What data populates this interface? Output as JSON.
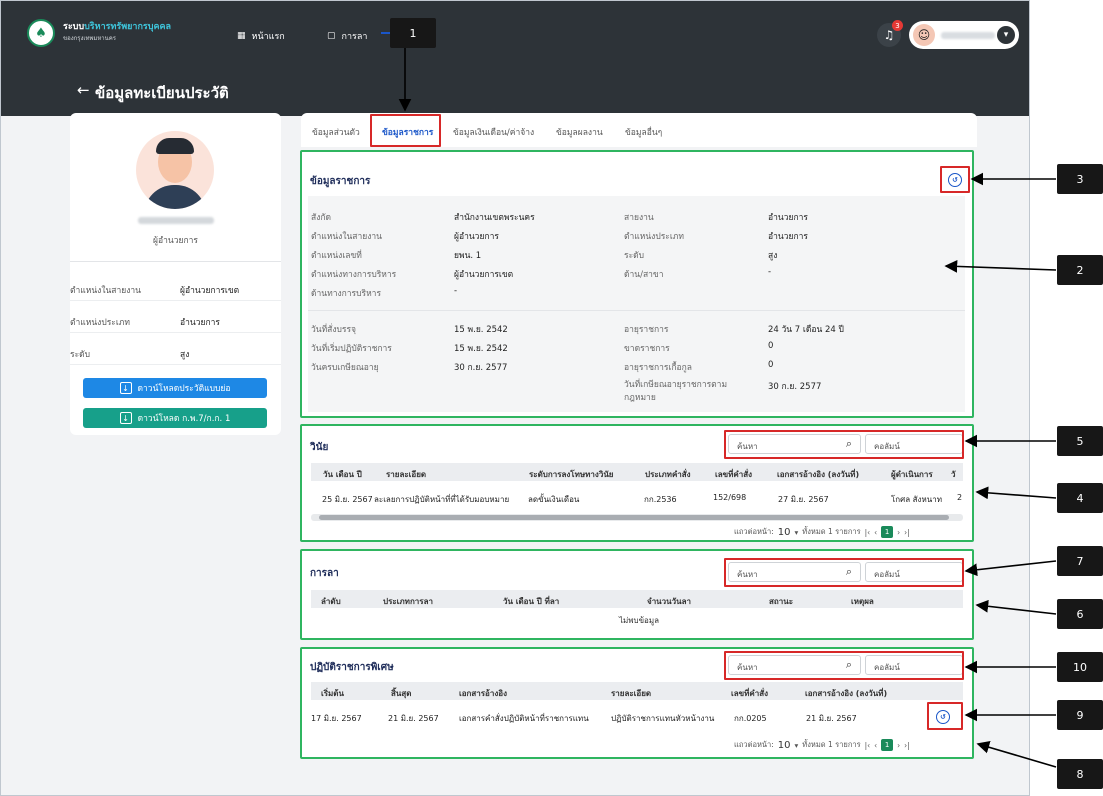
{
  "app": {
    "brand_main": "ระบบ",
    "brand_highlight": "บริหารทรัพยากรบุคคล",
    "brand_sub": "ของกรุงเทพมหานคร",
    "nav_home": "หน้าแรก",
    "nav_leave": "การลา",
    "notifications": "3"
  },
  "page": {
    "title": "ข้อมูลทะเบียนประวัติ"
  },
  "profile": {
    "role": "ผู้อำนวยการ",
    "rows": [
      {
        "k": "ตำแหน่งในสายงาน",
        "v": "ผู้อำนวยการเขต"
      },
      {
        "k": "ตำแหน่งประเภท",
        "v": "อำนวยการ"
      },
      {
        "k": "ระดับ",
        "v": "สูง"
      }
    ],
    "btn_download_profile": "ดาวน์โหลดประวัติแบบย่อ",
    "btn_download_gp7": "ดาวน์โหลด ก.พ.7/ก.ก. 1"
  },
  "tabs": [
    "ข้อมูลส่วนตัว",
    "ข้อมูลราชการ",
    "ข้อมูลเงินเดือน/ค่าจ้าง",
    "ข้อมูลผลงาน",
    "ข้อมูลอื่นๆ"
  ],
  "official": {
    "title": "ข้อมูลราชการ",
    "fields": {
      "affiliation_k": "สังกัด",
      "affiliation_v": "สำนักงานเขตพระนคร",
      "line_k": "สายงาน",
      "line_v": "อำนวยการ",
      "pos_line_k": "ตำแหน่งในสายงาน",
      "pos_line_v": "ผู้อำนวยการ",
      "pos_type_k": "ตำแหน่งประเภท",
      "pos_type_v": "อำนวยการ",
      "pos_no_k": "ตำแหน่งเลขที่",
      "pos_no_v": "ยพน. 1",
      "level_k": "ระดับ",
      "level_v": "สูง",
      "mgmt_pos_k": "ตำแหน่งทางการบริหาร",
      "mgmt_pos_v": "ผู้อำนวยการเขต",
      "field_k": "ด้าน/สาขา",
      "field_v": "-",
      "mgmt_side_k": "ด้านทางการบริหาร",
      "mgmt_side_v": "-",
      "appoint_k": "วันที่สั่งบรรจุ",
      "appoint_v": "15 พ.ย. 2542",
      "service_age_k": "อายุราชการ",
      "service_age_v": "24 วัน 7 เดือน 24 ปี",
      "start_k": "วันที่เริ่มปฏิบัติราชการ",
      "start_v": "15 พ.ย. 2542",
      "absent_k": "ขาดราชการ",
      "absent_v": "0",
      "retire_k": "วันครบเกษียณอายุ",
      "retire_v": "30 ก.ย. 2577",
      "support_k": "อายุราชการเกื้อกูล",
      "support_v": "0",
      "retire_law_k": "วันที่เกษียณอายุราชการตามกฎหมาย",
      "retire_law_v": "30 ก.ย. 2577"
    }
  },
  "discipline": {
    "title": "วินัย",
    "search_placeholder": "ค้นหา",
    "column_placeholder": "คอลัมน์",
    "headers": [
      "วัน เดือน ปี",
      "รายละเอียด",
      "ระดับการลงโทษทางวินัย",
      "ประเภทคำสั่ง",
      "เลขที่คำสั่ง",
      "เอกสารอ้างอิง (ลงวันที่)",
      "ผู้ดำเนินการ",
      "วั"
    ],
    "row": [
      "25 มิ.ย. 2567",
      "ละเลยการปฏิบัติหน้าที่ที่ได้รับมอบหมาย",
      "ลดขั้นเงินเดือน",
      "กก.2536",
      "152/698",
      "27 มิ.ย. 2567",
      "โกศล สังหนาท",
      "2"
    ],
    "pager_label": "แถวต่อหน้า:",
    "pager_size": "10",
    "pager_total": "ทั้งหมด 1 รายการ",
    "pager_page": "1"
  },
  "leave": {
    "title": "การลา",
    "search_placeholder": "ค้นหา",
    "column_placeholder": "คอลัมน์",
    "headers": [
      "ลำดับ",
      "ประเภทการลา",
      "วัน เดือน ปี ที่ลา",
      "จำนวนวันลา",
      "สถานะ",
      "เหตุผล"
    ],
    "empty": "ไม่พบข้อมูล"
  },
  "special": {
    "title": "ปฏิบัติราชการพิเศษ",
    "search_placeholder": "ค้นหา",
    "column_placeholder": "คอลัมน์",
    "headers": [
      "เริ่มต้น",
      "สิ้นสุด",
      "เอกสารอ้างอิง",
      "รายละเอียด",
      "เลขที่คำสั่ง",
      "เอกสารอ้างอิง (ลงวันที่)"
    ],
    "row": [
      "17 มิ.ย. 2567",
      "21 มิ.ย. 2567",
      "เอกสารคำสั่งปฏิบัติหน้าที่ราชการแทน",
      "ปฏิบัติราชการแทนหัวหน้างาน",
      "กก.0205",
      "21 มิ.ย. 2567"
    ],
    "pager_label": "แถวต่อหน้า:",
    "pager_size": "10",
    "pager_total": "ทั้งหมด 1 รายการ",
    "pager_page": "1"
  },
  "callouts": [
    "1",
    "2",
    "3",
    "4",
    "5",
    "6",
    "7",
    "8",
    "9",
    "10"
  ],
  "colors": {
    "annotation_green": "#2fb560",
    "annotation_red": "#d72828",
    "accent_blue": "#1a56c8",
    "accent_green": "#1a8a5a"
  }
}
